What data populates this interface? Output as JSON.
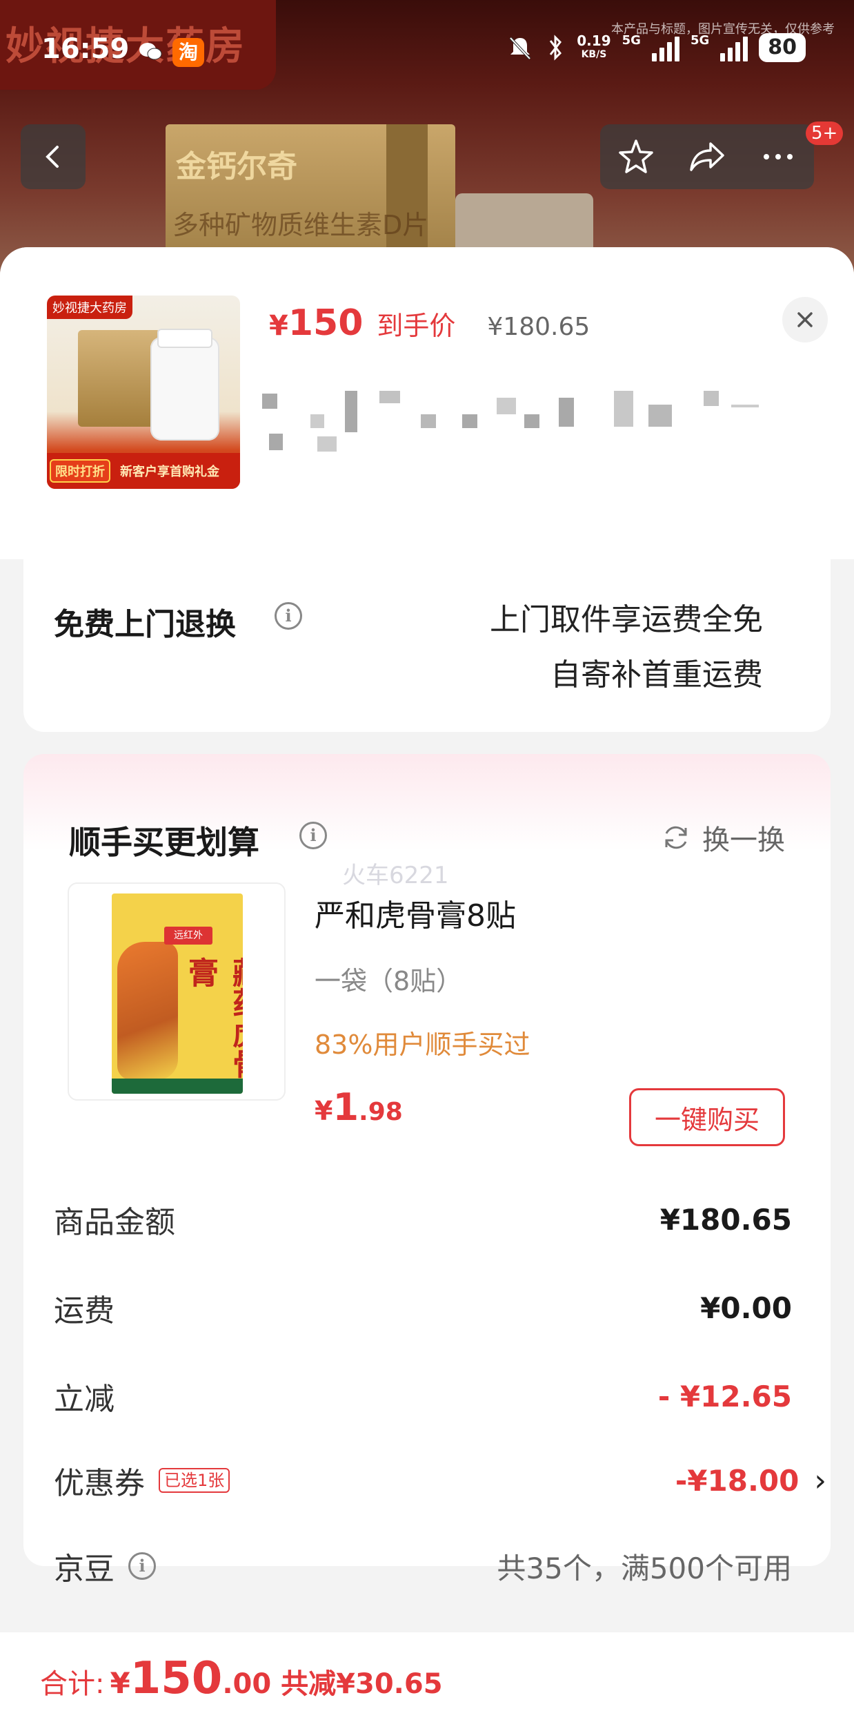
{
  "background": {
    "shop_name": "妙视捷大药房",
    "notice": "本产品与标题，图片宣传无关，仅供参考",
    "box_brand": "金钙尔奇",
    "box_subtitle": "多种矿物质维生素D片"
  },
  "status_bar": {
    "time": "16:59",
    "app_badge": "淘",
    "net_speed": "0.19",
    "net_speed_unit": "KB/S",
    "net_type_1": "5G",
    "net_type_2": "5G",
    "battery": "80"
  },
  "nav": {
    "badge": "5+"
  },
  "sheet": {
    "thumb_shop": "妙视捷大药房",
    "thumb_promo_tag": "限时打折",
    "thumb_promo_text": "新客户享首购礼金",
    "price_symbol": "¥",
    "price_value": "150",
    "price_label": "到手价",
    "price_original": "¥180.65"
  },
  "return_card": {
    "title": "免费上门退换",
    "desc_line1": "上门取件享运费全免",
    "desc_line2": "自寄补首重运费"
  },
  "buy_card": {
    "title": "顺手买更划算",
    "watermark": "火车6221",
    "swap_label": "换一换",
    "product_name": "严和虎骨膏8贴",
    "product_spec": "一袋（8贴）",
    "product_rate": "83%用户顺手买过",
    "price_symbol": "¥",
    "price_int": "1",
    "price_dec": ".98",
    "buy_button": "一键购买",
    "plaster_head": "远红外",
    "plaster_title": "藏药虎骨膏"
  },
  "summary": {
    "rows": [
      {
        "label": "商品金额",
        "value": "¥180.65"
      },
      {
        "label": "运费",
        "value": "¥0.00"
      },
      {
        "label": "立减",
        "value": "- ¥12.65"
      },
      {
        "label": "优惠券",
        "tag": "已选1张",
        "value": "-¥18.00"
      },
      {
        "label": "京豆",
        "value": "共35个，满500个可用"
      }
    ]
  },
  "footer": {
    "total_label": "合计:",
    "total_symbol": "¥",
    "total_int": "150",
    "total_dec": ".00",
    "total_save": "共减¥30.65"
  },
  "colors": {
    "accent": "#e4393c",
    "rate": "#e08a3a"
  }
}
